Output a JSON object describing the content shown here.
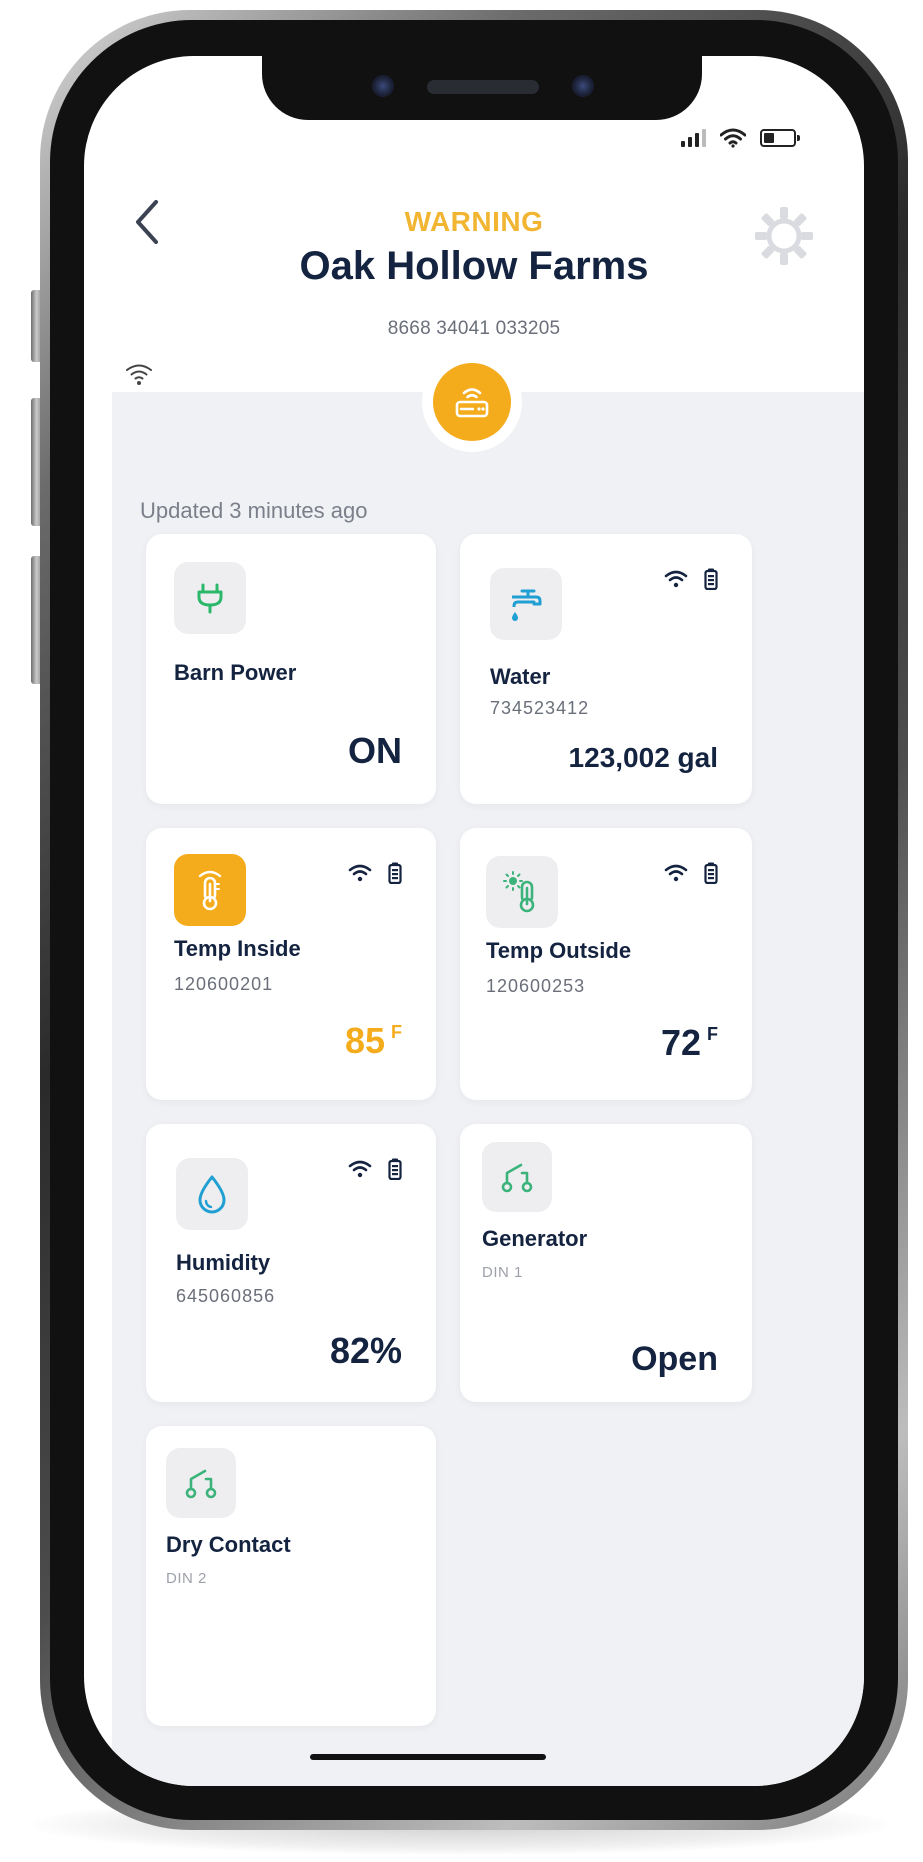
{
  "header": {
    "status": "WARNING",
    "site_name": "Oak Hollow Farms",
    "site_id": "8668 34041 033205",
    "updated": "Updated 3 minutes ago"
  },
  "colors": {
    "warning": "#f2b531",
    "alert_orange": "#f4ac1c",
    "title_navy": "#14233f",
    "power_green": "#2bb86a",
    "water_blue": "#1f9fd2",
    "thermo_green": "#3bb37a"
  },
  "cards": [
    {
      "name": "Barn Power",
      "serial": "",
      "value": "ON",
      "unit": "",
      "icon": "plug-icon",
      "alert": false
    },
    {
      "name": "Water",
      "serial": "734523412",
      "value": "123,002 gal",
      "unit": "",
      "icon": "faucet-icon",
      "alert": false
    },
    {
      "name": "Temp Inside",
      "serial": "120600201",
      "value": "85",
      "unit": "F",
      "icon": "thermometer-icon",
      "alert": true
    },
    {
      "name": "Temp Outside",
      "serial": "120600253",
      "value": "72",
      "unit": "F",
      "icon": "thermometer-sun-icon",
      "alert": false
    },
    {
      "name": "Humidity",
      "serial": "645060856",
      "value": "82%",
      "unit": "",
      "icon": "water-drop-icon",
      "alert": false
    },
    {
      "name": "Generator",
      "serial": "DIN 1",
      "value": "Open",
      "unit": "",
      "icon": "dry-contact-icon",
      "alert": false
    },
    {
      "name": "Dry Contact",
      "serial": "DIN 2",
      "value": "",
      "unit": "",
      "icon": "dry-contact-icon",
      "alert": false
    }
  ]
}
